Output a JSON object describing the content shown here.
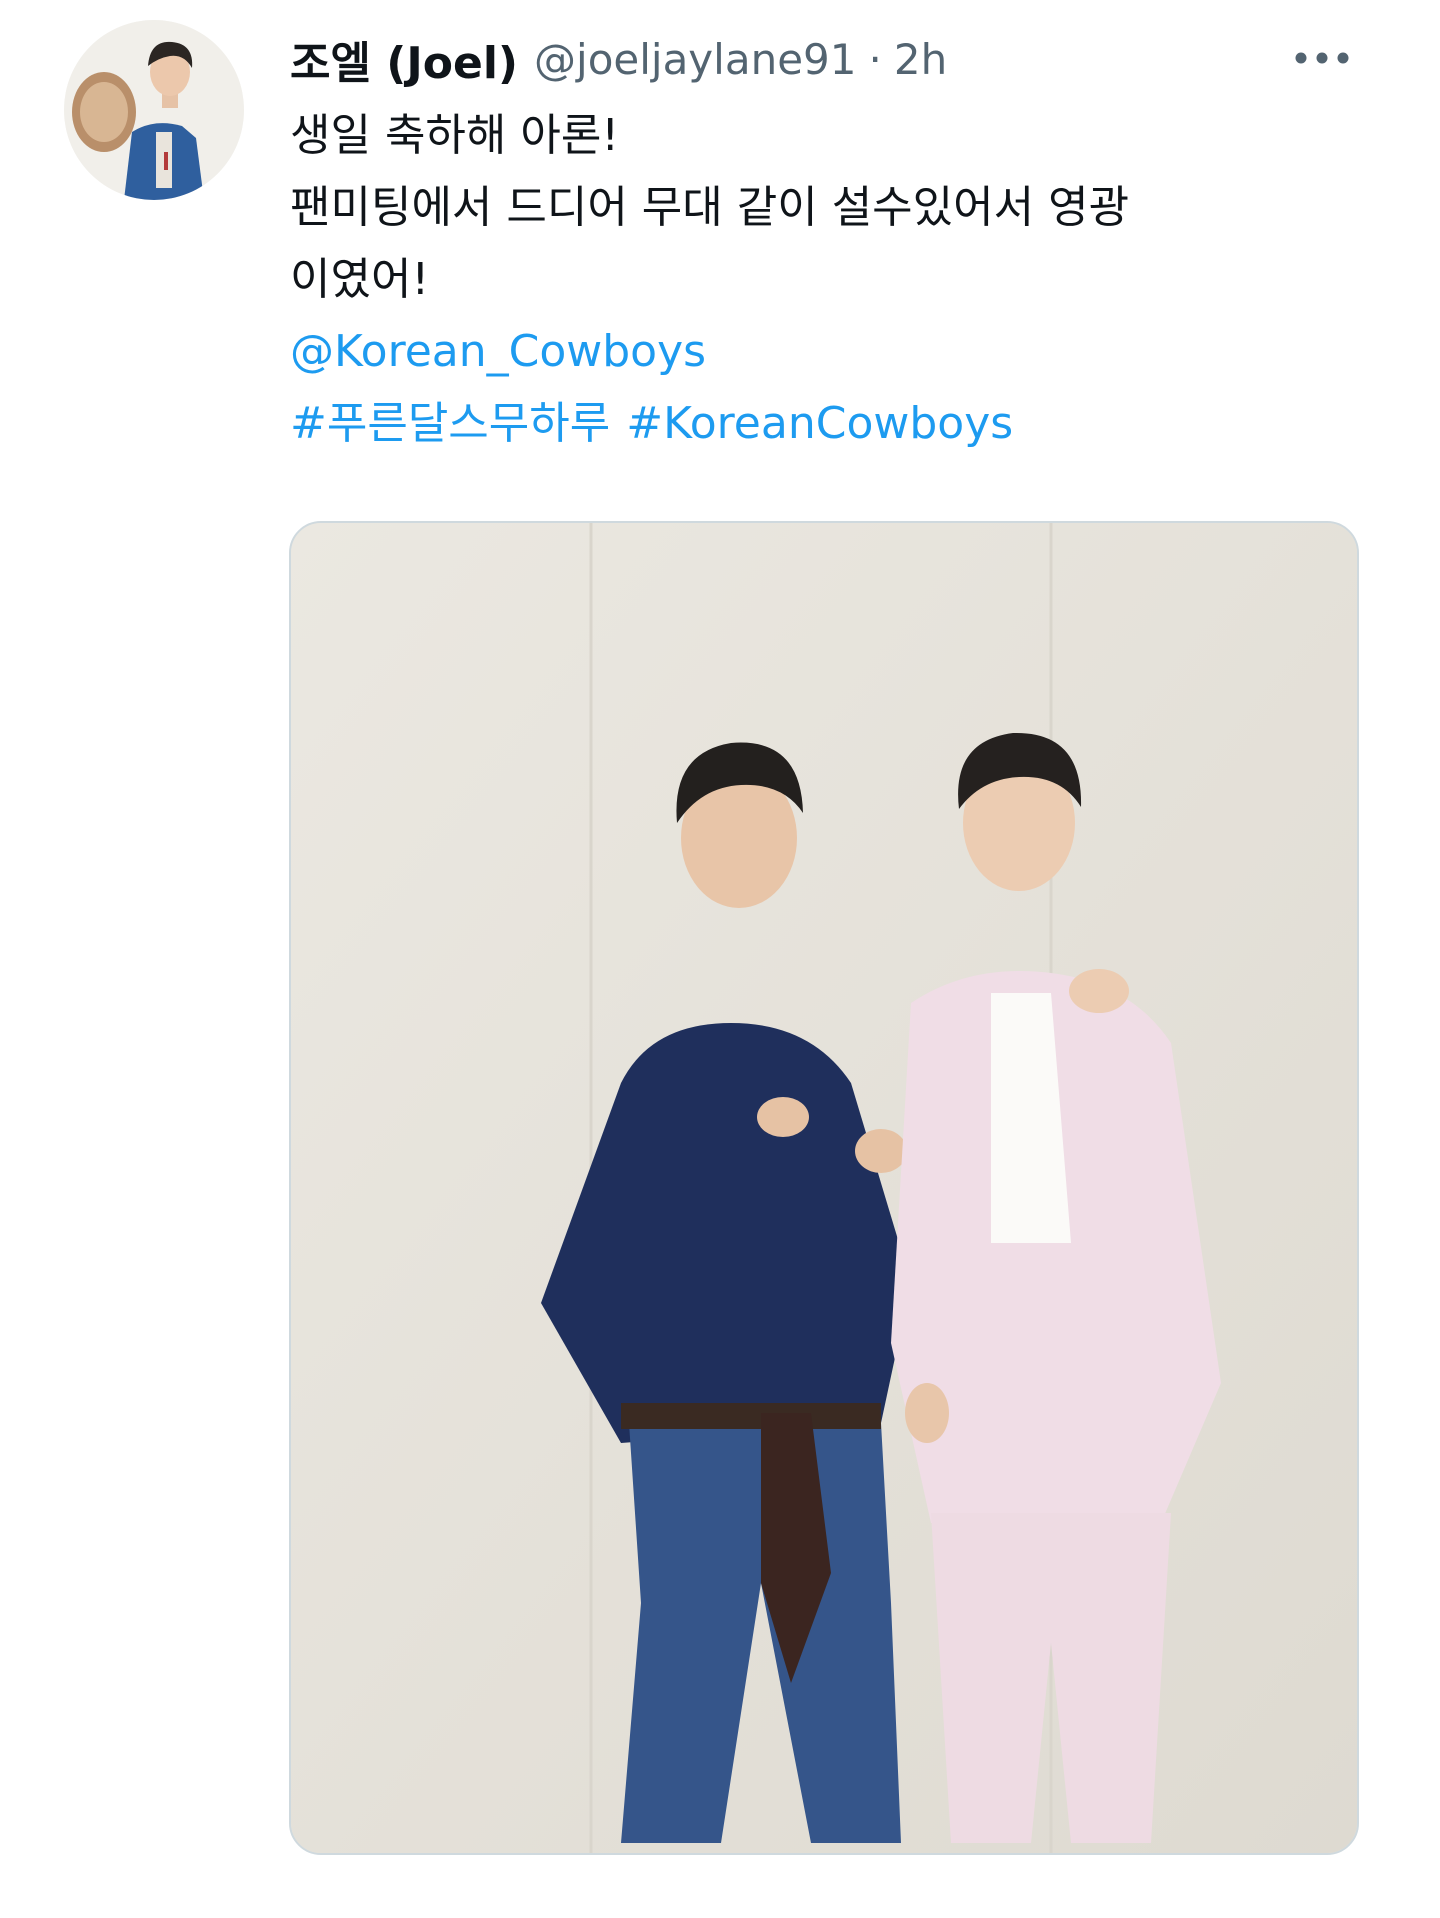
{
  "tweet": {
    "display_name": "조엘 (Joel)",
    "handle": "@joeljaylane91",
    "separator": "·",
    "timestamp": "2h",
    "more_icon": "more-horizontal-icon",
    "text_lines": [
      "생일 축하해 아론!",
      "팬미팅에서 드디어 무대 같이 설수있어서 영광",
      "이였어!"
    ],
    "mention": "@Korean_Cowboys",
    "hashtags": [
      "#푸른달스무하루",
      "#KoreanCowboys"
    ]
  },
  "colors": {
    "text": "#0f1419",
    "secondary": "#536471",
    "link": "#1d9bf0",
    "media_border": "#cfd9de"
  }
}
